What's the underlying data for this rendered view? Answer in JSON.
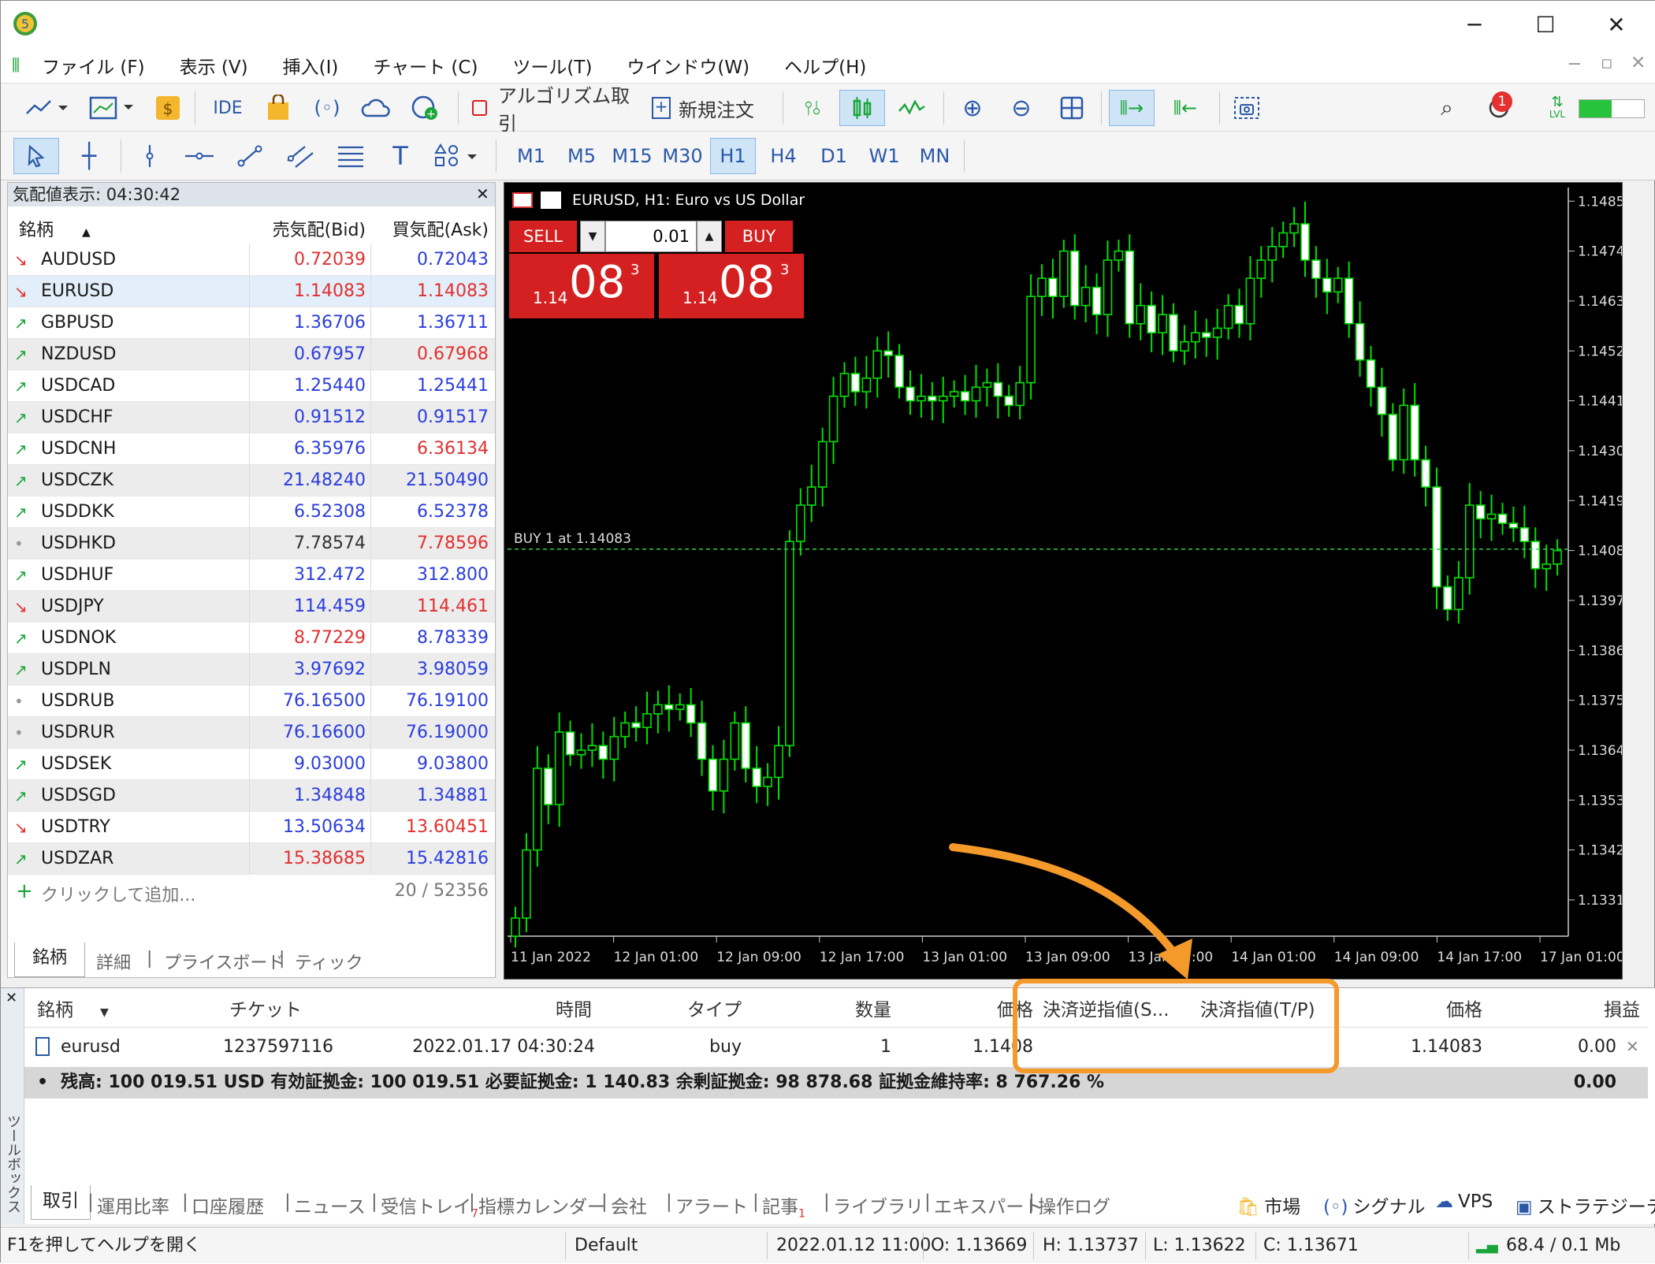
{
  "menu": [
    "ファイル (F)",
    "表示 (V)",
    "挿入(I)",
    "チャート (C)",
    "ツール(T)",
    "ウインドウ(W)",
    "ヘルプ(H)"
  ],
  "toolbar": {
    "ide_label": "IDE",
    "algo_label": "アルゴリズム取引",
    "new_order_label": "新規注文",
    "notification_count": "1",
    "lvl_label": "LVL"
  },
  "timeframes": [
    "M1",
    "M5",
    "M15",
    "M30",
    "H1",
    "H4",
    "D1",
    "W1",
    "MN"
  ],
  "active_timeframe": "H1",
  "market_watch": {
    "title": "気配値表示: 04:30:42",
    "col_symbol": "銘柄",
    "col_bid": "売気配(Bid)",
    "col_ask": "買気配(Ask)",
    "rows": [
      {
        "arrow": "down",
        "symbol": "AUDUSD",
        "bid": "0.72039",
        "ask": "0.72043",
        "bidc": "red",
        "askc": "blue"
      },
      {
        "arrow": "down",
        "symbol": "EURUSD",
        "bid": "1.14083",
        "ask": "1.14083",
        "bidc": "red",
        "askc": "red"
      },
      {
        "arrow": "up",
        "symbol": "GBPUSD",
        "bid": "1.36706",
        "ask": "1.36711",
        "bidc": "blue",
        "askc": "blue"
      },
      {
        "arrow": "up",
        "symbol": "NZDUSD",
        "bid": "0.67957",
        "ask": "0.67968",
        "bidc": "blue",
        "askc": "red"
      },
      {
        "arrow": "up",
        "symbol": "USDCAD",
        "bid": "1.25440",
        "ask": "1.25441",
        "bidc": "blue",
        "askc": "blue"
      },
      {
        "arrow": "up",
        "symbol": "USDCHF",
        "bid": "0.91512",
        "ask": "0.91517",
        "bidc": "blue",
        "askc": "blue"
      },
      {
        "arrow": "up",
        "symbol": "USDCNH",
        "bid": "6.35976",
        "ask": "6.36134",
        "bidc": "blue",
        "askc": "red"
      },
      {
        "arrow": "up",
        "symbol": "USDCZK",
        "bid": "21.48240",
        "ask": "21.50490",
        "bidc": "blue",
        "askc": "blue"
      },
      {
        "arrow": "up",
        "symbol": "USDDKK",
        "bid": "6.52308",
        "ask": "6.52378",
        "bidc": "blue",
        "askc": "blue"
      },
      {
        "arrow": "none",
        "symbol": "USDHKD",
        "bid": "7.78574",
        "ask": "7.78596",
        "bidc": "dark",
        "askc": "red"
      },
      {
        "arrow": "up",
        "symbol": "USDHUF",
        "bid": "312.472",
        "ask": "312.800",
        "bidc": "blue",
        "askc": "blue"
      },
      {
        "arrow": "down",
        "symbol": "USDJPY",
        "bid": "114.459",
        "ask": "114.461",
        "bidc": "blue",
        "askc": "red"
      },
      {
        "arrow": "up",
        "symbol": "USDNOK",
        "bid": "8.77229",
        "ask": "8.78339",
        "bidc": "red",
        "askc": "blue"
      },
      {
        "arrow": "up",
        "symbol": "USDPLN",
        "bid": "3.97692",
        "ask": "3.98059",
        "bidc": "blue",
        "askc": "blue"
      },
      {
        "arrow": "none",
        "symbol": "USDRUB",
        "bid": "76.16500",
        "ask": "76.19100",
        "bidc": "blue",
        "askc": "blue"
      },
      {
        "arrow": "none",
        "symbol": "USDRUR",
        "bid": "76.16600",
        "ask": "76.19000",
        "bidc": "blue",
        "askc": "blue"
      },
      {
        "arrow": "up",
        "symbol": "USDSEK",
        "bid": "9.03000",
        "ask": "9.03800",
        "bidc": "blue",
        "askc": "blue"
      },
      {
        "arrow": "up",
        "symbol": "USDSGD",
        "bid": "1.34848",
        "ask": "1.34881",
        "bidc": "blue",
        "askc": "blue"
      },
      {
        "arrow": "down",
        "symbol": "USDTRY",
        "bid": "13.50634",
        "ask": "13.60451",
        "bidc": "blue",
        "askc": "red"
      },
      {
        "arrow": "up",
        "symbol": "USDZAR",
        "bid": "15.38685",
        "ask": "15.42816",
        "bidc": "red",
        "askc": "blue"
      }
    ],
    "add_label": "クリックして追加...",
    "count": "20 / 52356",
    "tabs": [
      "銘柄",
      "詳細",
      "プライスボード",
      "ティック"
    ]
  },
  "chart": {
    "title": "EURUSD, H1:  Euro vs US Dollar",
    "sell_label": "SELL",
    "buy_label": "BUY",
    "volume": "0.01",
    "sell_price": {
      "prefix": "1.14",
      "big": "08",
      "sup": "3"
    },
    "buy_price": {
      "prefix": "1.14",
      "big": "08",
      "sup": "3"
    },
    "order_line_label": "BUY 1 at 1.14083",
    "order_line_price": 1.14083,
    "price_ticks": [
      "1.14850",
      "1.14740",
      "1.14630",
      "1.14520",
      "1.14410",
      "1.14300",
      "1.14190",
      "1.14080",
      "1.13970",
      "1.13860",
      "1.13750",
      "1.13640",
      "1.13530",
      "1.13420",
      "1.13310"
    ],
    "time_ticks": [
      "11 Jan 2022",
      "12 Jan 01:00",
      "12 Jan 09:00",
      "12 Jan 17:00",
      "13 Jan 01:00",
      "13 Jan 09:00",
      "13 Jan 17:00",
      "14 Jan 01:00",
      "14 Jan 09:00",
      "14 Jan 17:00",
      "17 Jan 01:00"
    ],
    "ylim": [
      1.1323,
      1.1488
    ],
    "closes": [
      1.1327,
      1.1342,
      1.136,
      1.1352,
      1.1368,
      1.1363,
      1.1364,
      1.1365,
      1.1362,
      1.1367,
      1.137,
      1.1369,
      1.1372,
      1.1374,
      1.1373,
      1.1374,
      1.137,
      1.1362,
      1.1355,
      1.1362,
      1.137,
      1.136,
      1.1356,
      1.1358,
      1.1365,
      1.141,
      1.1418,
      1.1422,
      1.1432,
      1.1442,
      1.1447,
      1.1443,
      1.1446,
      1.1452,
      1.1451,
      1.1444,
      1.1441,
      1.1442,
      1.1441,
      1.1442,
      1.1443,
      1.1441,
      1.1444,
      1.1445,
      1.1442,
      1.144,
      1.1445,
      1.1464,
      1.1468,
      1.1464,
      1.1474,
      1.1462,
      1.1466,
      1.146,
      1.1472,
      1.1474,
      1.1458,
      1.1462,
      1.1456,
      1.146,
      1.1452,
      1.1454,
      1.1456,
      1.1455,
      1.1457,
      1.1462,
      1.1458,
      1.1468,
      1.1472,
      1.1475,
      1.1478,
      1.148,
      1.1472,
      1.1468,
      1.1465,
      1.1468,
      1.1458,
      1.145,
      1.1444,
      1.1438,
      1.1428,
      1.144,
      1.1428,
      1.1422,
      1.14,
      1.1395,
      1.1402,
      1.1418,
      1.1415,
      1.1416,
      1.1414,
      1.1413,
      1.141,
      1.1404,
      1.1405,
      1.1408
    ]
  },
  "positions": {
    "headers": {
      "symbol": "銘柄",
      "ticket": "チケット",
      "time": "時間",
      "type": "タイプ",
      "volume": "数量",
      "price": "価格",
      "sl": "決済逆指値(S...",
      "tp": "決済指値(T/P)",
      "cur_price": "価格",
      "profit": "損益"
    },
    "row": {
      "symbol": "eurusd",
      "ticket": "1237597116",
      "time": "2022.01.17 04:30:24",
      "type": "buy",
      "volume": "1",
      "price": "1.1408",
      "sl": "",
      "tp": "",
      "cur_price": "1.14083",
      "profit": "0.00"
    },
    "balance_text": "残高: 100 019.51 USD  有効証拠金: 100 019.51  必要証拠金: 1 140.83  余剰証拠金: 98 878.68  証拠金維持率: 8 767.26 %",
    "balance_profit": "0.00",
    "side_label": "ツールボックス",
    "tabs": [
      "取引",
      "運用比率",
      "口座履歴",
      "ニュース",
      "受信トレイ",
      "指標カレンダー",
      "会社",
      "アラート",
      "記事",
      "ライブラリ",
      "エキスパート",
      "操作ログ"
    ],
    "inbox_badge": "7",
    "articles_badge": "1",
    "extras": [
      "市場",
      "シグナル",
      "VPS",
      "ストラテジーテスタ"
    ]
  },
  "status": {
    "help": "F1を押してヘルプを開く",
    "profile": "Default",
    "datetime": "2022.01.12 11:00",
    "open": "O: 1.13669",
    "high": "H: 1.13737",
    "low": "L: 1.13622",
    "close": "C: 1.13671",
    "traffic": "68.4 / 0.1 Mb"
  },
  "colors": {
    "bull": "#00e000",
    "sell_bg": "#d42020",
    "accent": "#f39a2a"
  }
}
